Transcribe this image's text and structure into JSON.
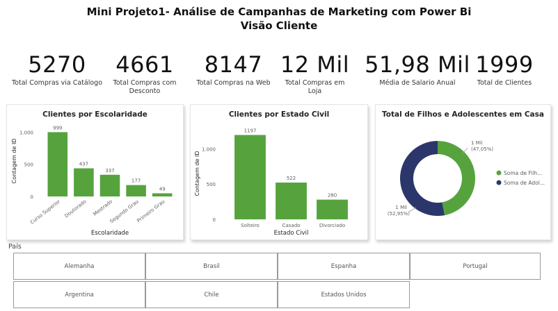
{
  "header": {
    "title": "Mini Projeto1- Análise de Campanhas de Marketing com Power Bi",
    "subtitle": "Visão Cliente"
  },
  "kpis": [
    {
      "value": "5270",
      "label": "Total Compras via Catálogo"
    },
    {
      "value": "4661",
      "label": "Total Compras com Desconto"
    },
    {
      "value": "8147",
      "label": "Total Compras na Web"
    },
    {
      "value": "12 Mil",
      "label": "Total Compras em Loja"
    },
    {
      "value": "51,98 Mil",
      "label": "Média de Salario Anual"
    },
    {
      "value": "1999",
      "label": "Total de Clientes"
    }
  ],
  "colors": {
    "bar": "#56a33e",
    "donut_green": "#56a33e",
    "donut_navy": "#2b376b",
    "axis_text": "#605e5c"
  },
  "chart_data": [
    {
      "type": "bar",
      "title": "Clientes por Escolaridade",
      "xlabel": "Escolaridade",
      "ylabel": "Contagem de ID",
      "categories": [
        "Curso Superior",
        "Doutorado",
        "Mestrado",
        "Segundo Grau",
        "Primeiro Grau"
      ],
      "values": [
        999,
        437,
        337,
        177,
        49
      ],
      "data_labels": [
        "999",
        "437",
        "337",
        "177",
        "49"
      ],
      "yticks": [
        "0",
        "500",
        "1.000"
      ],
      "ylim": [
        0,
        1100
      ],
      "grid": false
    },
    {
      "type": "bar",
      "title": "Clientes por Estado Civil",
      "xlabel": "Estado Civil",
      "ylabel": "Contagem de ID",
      "categories": [
        "Solteiro",
        "Casado",
        "Divorciado"
      ],
      "values": [
        1197,
        522,
        280
      ],
      "data_labels": [
        "1197",
        "522",
        "280"
      ],
      "yticks": [
        "0",
        "500",
        "1.000"
      ],
      "ylim": [
        0,
        1300
      ],
      "grid": false
    },
    {
      "type": "pie",
      "title": "Total de Filhos e Adolescentes em Casa",
      "series": [
        {
          "name": "Soma de Filh...",
          "value_label": "1 Mil",
          "percent_label": "(47,05%)",
          "value": 47.05
        },
        {
          "name": "Soma de Adol...",
          "value_label": "1 Mil",
          "percent_label": "(52,95%)",
          "value": 52.95
        }
      ],
      "legend_placement": "right"
    }
  ],
  "slicer": {
    "label": "País",
    "options": [
      "Alemanha",
      "Brasil",
      "Espanha",
      "Portugal",
      "Argentina",
      "Chile",
      "Estados Unidos"
    ]
  }
}
